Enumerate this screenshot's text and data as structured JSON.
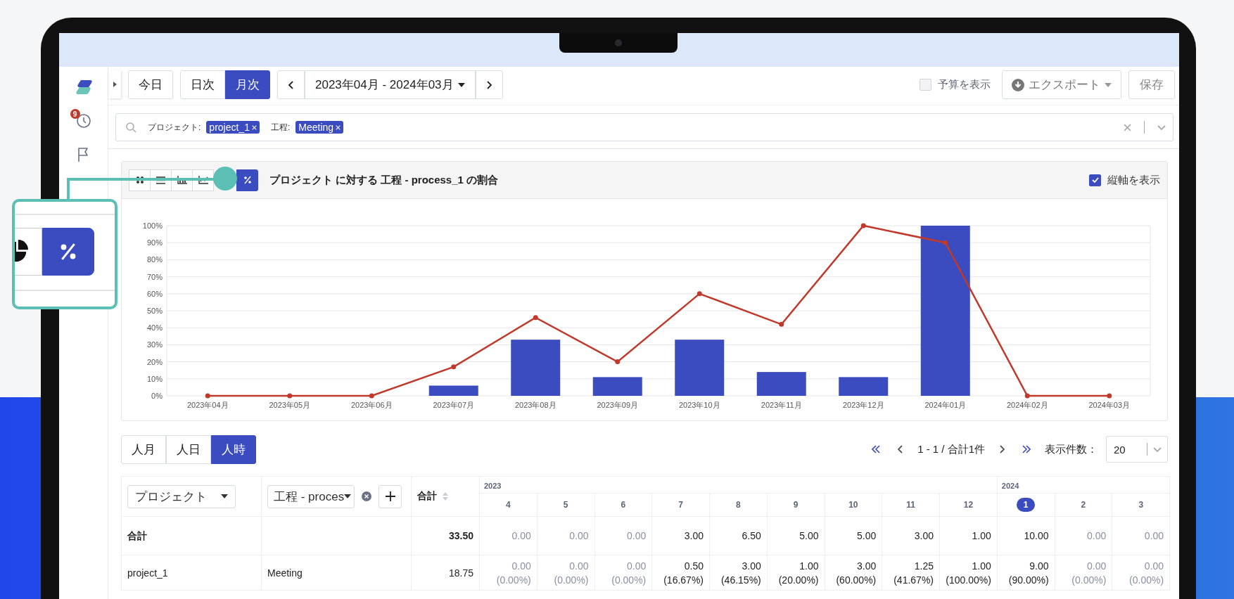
{
  "sidebar": {
    "items": [
      {
        "kind": "logo"
      },
      {
        "kind": "clock",
        "badge": "9"
      },
      {
        "kind": "flag"
      }
    ]
  },
  "toolbar": {
    "today": "今日",
    "granularity": [
      {
        "label": "日次",
        "selected": false
      },
      {
        "label": "月次",
        "selected": true
      }
    ],
    "period": "2023年04月 - 2024年03月",
    "budget": {
      "label": "予算を表示",
      "checked": false
    },
    "export": "エクスポート",
    "save": "保存"
  },
  "filter": {
    "chips": [
      {
        "label": "プロジェクト:",
        "value": "project_1"
      },
      {
        "label": "工程:",
        "value": "Meeting"
      }
    ]
  },
  "chart_panel": {
    "tools": [
      {
        "kind": "grid",
        "selected": false
      },
      {
        "kind": "list",
        "selected": false
      },
      {
        "kind": "bar",
        "selected": false
      },
      {
        "kind": "line",
        "selected": false
      },
      {
        "kind": "percent",
        "selected": true
      }
    ],
    "title": "プロジェクト に対する 工程 - process_1 の割合",
    "axis_toggle": {
      "label": "縦軸を表示",
      "checked": true
    },
    "chart_data": {
      "type": "bar",
      "categories": [
        "2023年04月",
        "2023年05月",
        "2023年06月",
        "2023年07月",
        "2023年08月",
        "2023年09月",
        "2023年10月",
        "2023年11月",
        "2023年12月",
        "2024年01月",
        "2024年02月",
        "2024年03月"
      ],
      "series": [
        {
          "color": "#3a4cbf",
          "values": [
            0,
            0,
            0,
            6,
            33,
            11,
            33,
            14,
            11,
            100,
            0,
            0
          ]
        },
        {
          "type": "line",
          "color": "#c0392b",
          "marker": true,
          "values": [
            0,
            0,
            0,
            17,
            46,
            20,
            60,
            42,
            100,
            90,
            0,
            0
          ]
        }
      ],
      "grid": true,
      "ylim": [
        0,
        100
      ],
      "yticks": [
        {
          "value": 0,
          "label": "0%"
        },
        {
          "value": 10,
          "label": "10%"
        },
        {
          "value": 20,
          "label": "20%"
        },
        {
          "value": 30,
          "label": "30%"
        },
        {
          "value": 40,
          "label": "40%"
        },
        {
          "value": 50,
          "label": "50%"
        },
        {
          "value": 60,
          "label": "60%"
        },
        {
          "value": 70,
          "label": "70%"
        },
        {
          "value": 80,
          "label": "80%"
        },
        {
          "value": 90,
          "label": "90%"
        },
        {
          "value": 100,
          "label": "100%"
        }
      ]
    }
  },
  "units": [
    {
      "label": "人月",
      "selected": false
    },
    {
      "label": "人日",
      "selected": false
    },
    {
      "label": "人時",
      "selected": true
    }
  ],
  "pagination": {
    "range": "1 - 1 / 合計1件",
    "page_size_label": "表示件数：",
    "page_size": "20"
  },
  "table": {
    "group_by": [
      "プロジェクト",
      "工程 - proces"
    ],
    "total_header": "合計",
    "years": [
      {
        "label": "2023",
        "months": [
          {
            "label": "4",
            "selected": false
          },
          {
            "label": "5",
            "selected": false
          },
          {
            "label": "6",
            "selected": false
          },
          {
            "label": "7",
            "selected": false
          },
          {
            "label": "8",
            "selected": false
          },
          {
            "label": "9",
            "selected": false
          },
          {
            "label": "10",
            "selected": false
          },
          {
            "label": "11",
            "selected": false
          },
          {
            "label": "12",
            "selected": false
          }
        ]
      },
      {
        "label": "2024",
        "months": [
          {
            "label": "1",
            "selected": true
          },
          {
            "label": "2",
            "selected": false
          },
          {
            "label": "3",
            "selected": false
          }
        ]
      }
    ],
    "rows": [
      {
        "kind": "total",
        "project": "合計",
        "total": "33.50",
        "values": [
          {
            "value": "0.00",
            "muted": true
          },
          {
            "value": "0.00",
            "muted": true
          },
          {
            "value": "0.00",
            "muted": true
          },
          {
            "value": "3.00",
            "muted": false
          },
          {
            "value": "6.50",
            "muted": false
          },
          {
            "value": "5.00",
            "muted": false
          },
          {
            "value": "5.00",
            "muted": false
          },
          {
            "value": "3.00",
            "muted": false
          },
          {
            "value": "1.00",
            "muted": false
          },
          {
            "value": "10.00",
            "muted": false
          },
          {
            "value": "0.00",
            "muted": true
          },
          {
            "value": "0.00",
            "muted": true
          }
        ]
      },
      {
        "kind": "item",
        "project": "project_1",
        "process": "Meeting",
        "total": "18.75",
        "values": [
          {
            "value": "0.00",
            "share": "(0.00%)",
            "muted": true
          },
          {
            "value": "0.00",
            "share": "(0.00%)",
            "muted": true
          },
          {
            "value": "0.00",
            "share": "(0.00%)",
            "muted": true
          },
          {
            "value": "0.50",
            "share": "(16.67%)",
            "muted": false
          },
          {
            "value": "3.00",
            "share": "(46.15%)",
            "muted": false
          },
          {
            "value": "1.00",
            "share": "(20.00%)",
            "muted": false
          },
          {
            "value": "3.00",
            "share": "(60.00%)",
            "muted": false
          },
          {
            "value": "1.25",
            "share": "(41.67%)",
            "muted": false
          },
          {
            "value": "1.00",
            "share": "(100.00%)",
            "muted": false
          },
          {
            "value": "9.00",
            "share": "(90.00%)",
            "muted": false
          },
          {
            "value": "0.00",
            "share": "(0.00%)",
            "muted": true
          },
          {
            "value": "0.00",
            "share": "(0.00%)",
            "muted": true
          }
        ]
      }
    ]
  },
  "callout": {
    "buttons": [
      {
        "kind": "pie",
        "selected": false
      },
      {
        "kind": "percent",
        "selected": true
      }
    ]
  }
}
